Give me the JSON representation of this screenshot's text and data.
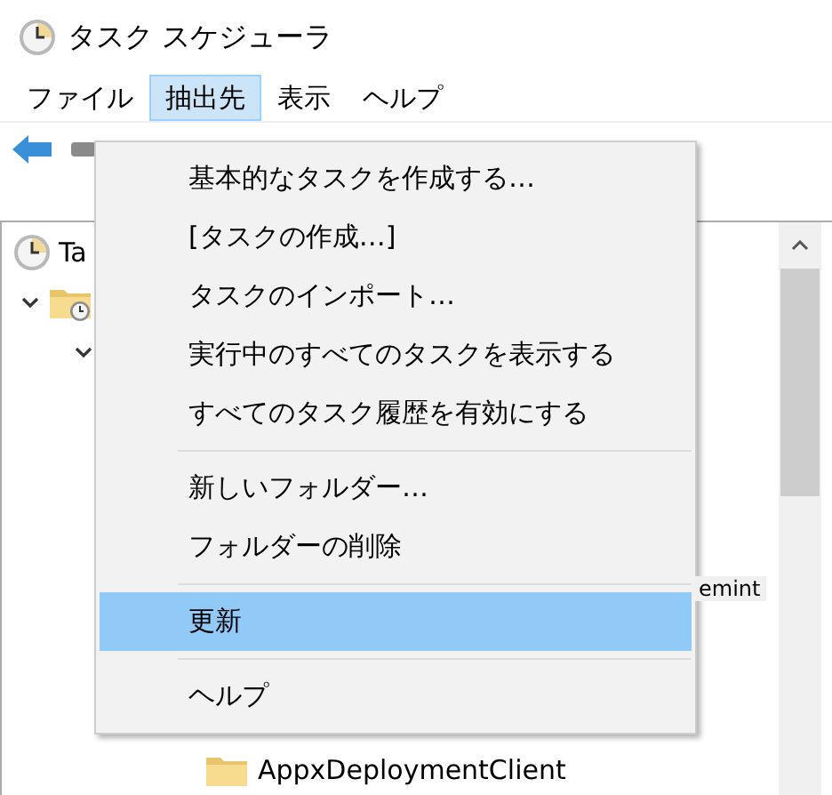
{
  "window": {
    "title": "タスク スケジューラ"
  },
  "menu_bar": [
    {
      "label": "ファイル",
      "selected": false
    },
    {
      "label": "抽出先",
      "selected": true
    },
    {
      "label": "表示",
      "selected": false
    },
    {
      "label": "ヘルプ",
      "selected": false
    }
  ],
  "dropdown": {
    "items": [
      {
        "kind": "item",
        "label": "基本的なタスクを作成する…",
        "selected": false
      },
      {
        "kind": "item",
        "label": "[タスクの作成…]",
        "selected": false
      },
      {
        "kind": "item",
        "label": "タスクのインポート…",
        "selected": false
      },
      {
        "kind": "item",
        "label": "実行中のすべてのタスクを表示する",
        "selected": false
      },
      {
        "kind": "item",
        "label": "すべてのタスク履歴を有効にする",
        "selected": false
      },
      {
        "kind": "separator"
      },
      {
        "kind": "item",
        "label": "新しいフォルダー…",
        "selected": false
      },
      {
        "kind": "item",
        "label": "フォルダーの削除",
        "selected": false
      },
      {
        "kind": "separator"
      },
      {
        "kind": "item",
        "label": "更新",
        "selected": true
      },
      {
        "kind": "separator"
      },
      {
        "kind": "item",
        "label": "ヘルプ",
        "selected": false
      }
    ]
  },
  "tree": {
    "items": [
      {
        "label": "Ta",
        "kind": "clock",
        "children": [
          {
            "kind": "clock-folder",
            "expanded": true,
            "children": [
              {
                "expanded": true,
                "children": [
                  {
                    "kind": "folder",
                    "label": "AppxDeploymentClient"
                  }
                ]
              }
            ]
          }
        ]
      }
    ],
    "fragment": "emint"
  }
}
